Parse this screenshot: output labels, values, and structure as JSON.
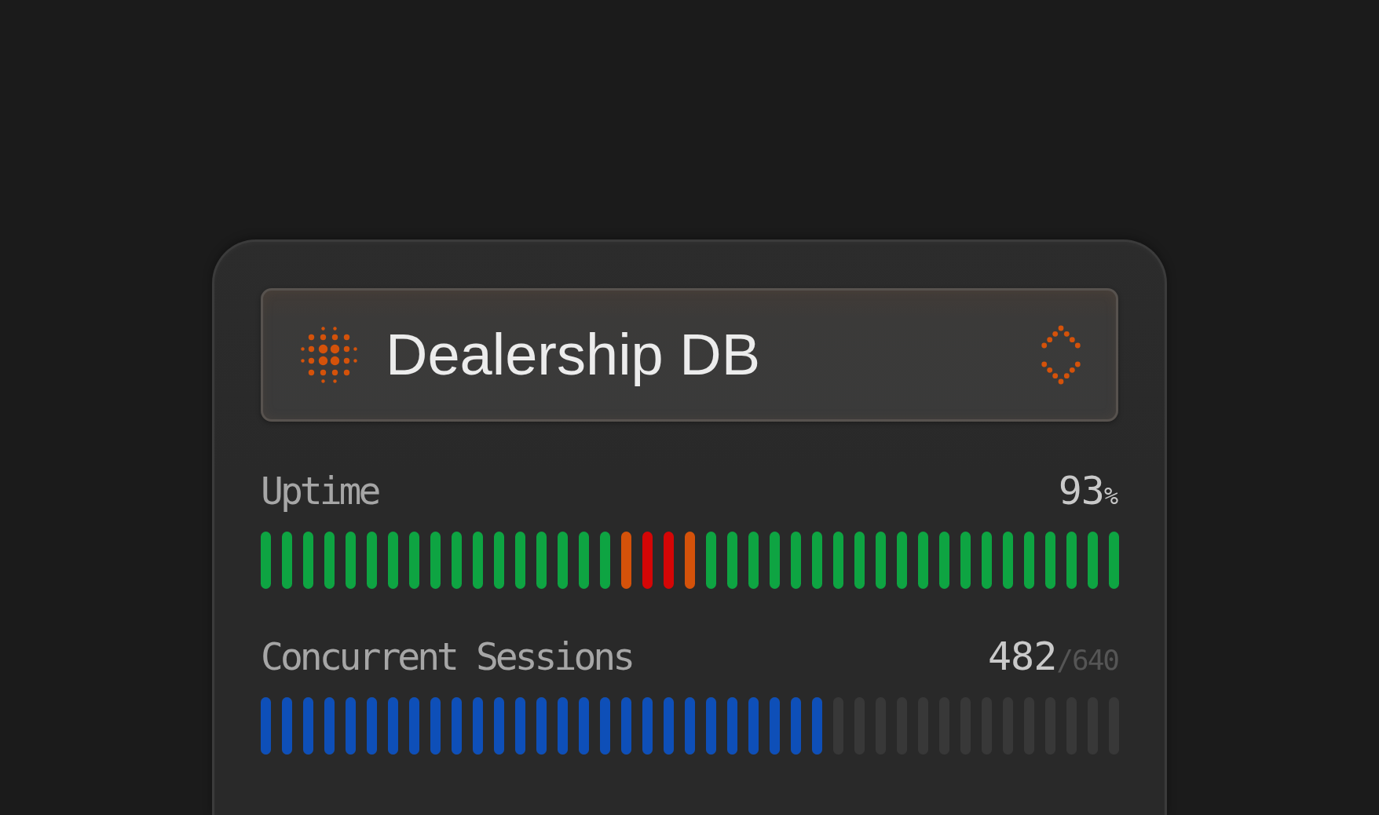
{
  "selector": {
    "title": "Dealership DB"
  },
  "metrics": [
    {
      "kind": "status",
      "label": "Uptime",
      "value": "93",
      "unit": "%",
      "segments": [
        {
          "color": "#0ea442"
        },
        {
          "color": "#0ea442"
        },
        {
          "color": "#0ea442"
        },
        {
          "color": "#0ea442"
        },
        {
          "color": "#0ea442"
        },
        {
          "color": "#0ea442"
        },
        {
          "color": "#0ea442"
        },
        {
          "color": "#0ea442"
        },
        {
          "color": "#0ea442"
        },
        {
          "color": "#0ea442"
        },
        {
          "color": "#0ea442"
        },
        {
          "color": "#0ea442"
        },
        {
          "color": "#0ea442"
        },
        {
          "color": "#0ea442"
        },
        {
          "color": "#0ea442"
        },
        {
          "color": "#0ea442"
        },
        {
          "color": "#0ea442"
        },
        {
          "color": "#d4520a"
        },
        {
          "color": "#d40606"
        },
        {
          "color": "#d40606"
        },
        {
          "color": "#d4520a"
        },
        {
          "color": "#0ea442"
        },
        {
          "color": "#0ea442"
        },
        {
          "color": "#0ea442"
        },
        {
          "color": "#0ea442"
        },
        {
          "color": "#0ea442"
        },
        {
          "color": "#0ea442"
        },
        {
          "color": "#0ea442"
        },
        {
          "color": "#0ea442"
        },
        {
          "color": "#0ea442"
        },
        {
          "color": "#0ea442"
        },
        {
          "color": "#0ea442"
        },
        {
          "color": "#0ea442"
        },
        {
          "color": "#0ea442"
        },
        {
          "color": "#0ea442"
        },
        {
          "color": "#0ea442"
        },
        {
          "color": "#0ea442"
        },
        {
          "color": "#0ea442"
        },
        {
          "color": "#0ea442"
        },
        {
          "color": "#0ea442"
        },
        {
          "color": "#0ea442"
        }
      ]
    },
    {
      "kind": "capacity",
      "label": "Concurrent Sessions",
      "value": "482",
      "total": "/640",
      "level": 0.66
    }
  ]
}
